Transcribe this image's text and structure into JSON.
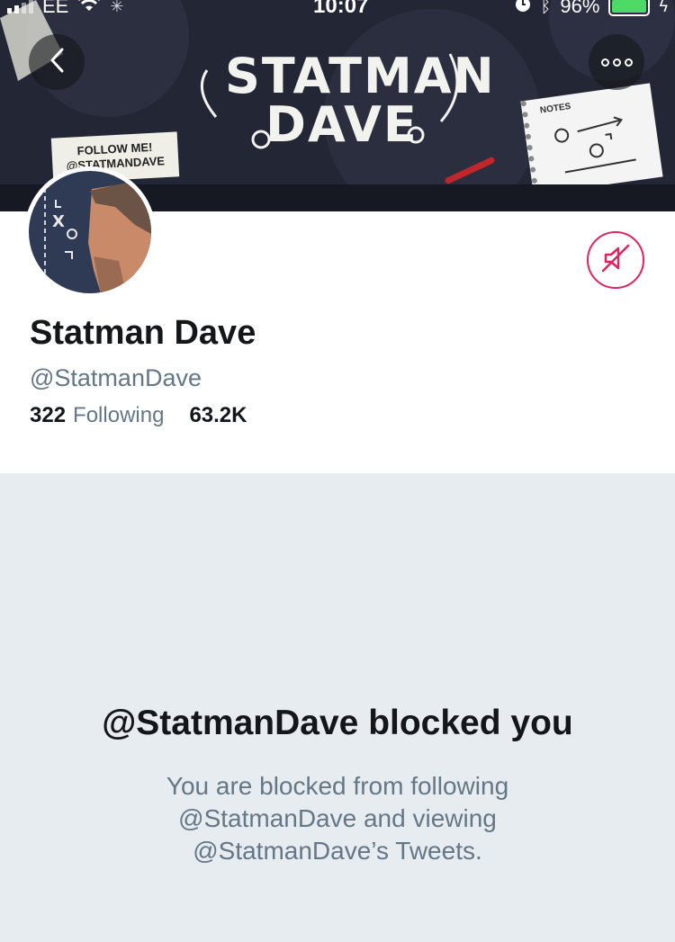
{
  "status_bar": {
    "carrier": "EE",
    "time": "10:07",
    "battery": "96%"
  },
  "banner": {
    "title_line1": "STATMAN",
    "title_line2": "DAVE",
    "follow_card_line1": "FOLLOW ME!",
    "follow_card_line2": "@STATMANDAVE",
    "notebook_label": "NOTES"
  },
  "header": {
    "back_icon": "chevron-left-icon",
    "more_icon": "more-horizontal-icon"
  },
  "profile": {
    "display_name": "Statman Dave",
    "handle": "@StatmanDave",
    "following_count": "322",
    "following_label": "Following",
    "followers_count": "63.2K",
    "mute_icon": "muted-speaker-icon",
    "accent_color": "#e0245e"
  },
  "blocked_notice": {
    "title": "@StatmanDave blocked you",
    "body": "You are blocked from following @StatmanDave and viewing @StatmanDave’s Tweets."
  }
}
